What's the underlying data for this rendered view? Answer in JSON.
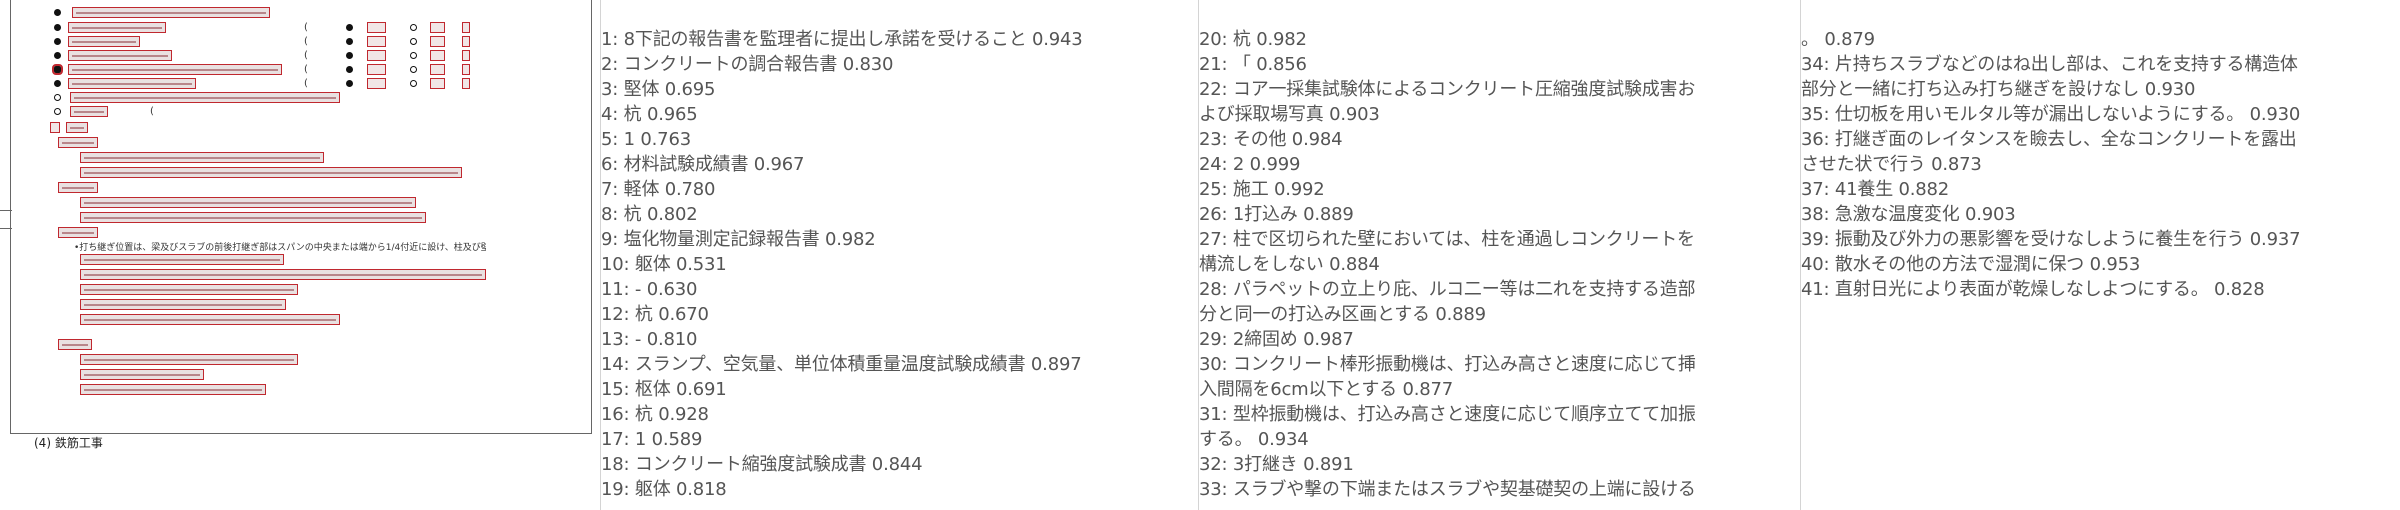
{
  "thumbnail": {
    "footer_text": "(4) 鉄筋工事"
  },
  "results": {
    "columns": [
      [
        "1: 8下記の報告書を監理者に提出し承諾を受けること  0.943",
        "2: コンクリートの調合報告書  0.830",
        "3: 堅体  0.695",
        "4: 杭  0.965",
        "5: 1  0.763",
        "6: 材料試験成績書  0.967",
        "7: 軽体  0.780",
        "8: 杭  0.802",
        "9: 塩化物量測定記録報告書  0.982",
        "10: 躯体  0.531",
        "11: -  0.630",
        "12: 杭  0.670",
        "13: -  0.810",
        "14: スランプ、空気量、単位体積重量温度試験成績書  0.897",
        "15: 枢体  0.691",
        "16: 杭  0.928",
        "17: 1  0.589",
        "18: コンクリート縮強度試験成書  0.844",
        "19: 躯体  0.818"
      ],
      [
        "20: 杭  0.982",
        "21: 「  0.856",
        "22: コア一採集試験体によるコンクリート圧縮強度試験成害お",
        "よび採取場写真  0.903",
        "23: その他  0.984",
        "24: 2  0.999",
        "25: 施工  0.992",
        "26: 1打込み  0.889",
        "27: 柱で区切られた壁においては、柱を通過しコンクリートを",
        "構流しをしない  0.884",
        "28: パラペットの立上り庇、ルコ二ー等は二れを支持する造部",
        "分と同一の打込み区画とする  0.889",
        "29: 2締固め  0.987",
        "30: コンクリート棒形振動機は、打込み高さと速度に応じて挿",
        "入間隔を6cm以下とする  0.877",
        "31: 型枠振動機は、打込み高さと速度に応じて順序立てて加振",
        "する。  0.934",
        "32: 3打継き  0.891",
        "33: スラブや撃の下端またはスラブや契基礎契の上端に設ける"
      ],
      [
        "。  0.879",
        "34: 片持ちスラブなどのはね出し部は、これを支持する構造体",
        "部分と一緒に打ち込み打ち継ぎを設けなし  0.930",
        "35: 仕切板を用いモルタル等が漏出しないようにする。  0.930",
        "36: 打継ぎ面のレイタンスを瞼去し、全なコンクリートを露出",
        "させた状で行う  0.873",
        "37: 41養生  0.882",
        "38: 急激な温度変化  0.903",
        "39: 振動及び外力の悪影響を受けなしように養生を行う  0.937",
        "40: 散水その他の方法で湿潤に保つ  0.953",
        "41: 直射日光により表面が乾燥しなしよつにする。  0.828"
      ]
    ]
  }
}
